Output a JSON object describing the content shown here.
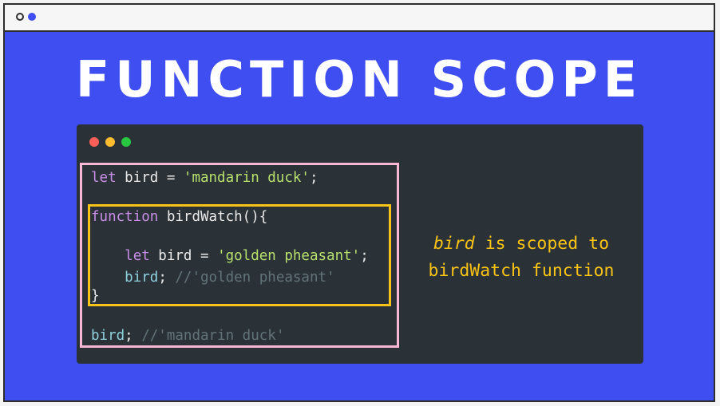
{
  "title": "FUNCTION SCOPE",
  "code": {
    "line1": {
      "kw": "let",
      "text": " bird = ",
      "str": "'mandarin duck'",
      "end": ";"
    },
    "line2": {
      "kw": "function",
      "text": " birdWatch(){"
    },
    "line3": {
      "indent": "    ",
      "kw": "let",
      "text": " bird = ",
      "str": "'golden pheasant'",
      "end": ";"
    },
    "line4": {
      "indent": "    ",
      "ref": "bird",
      "end": ";",
      "cmt": " //'golden pheasant'"
    },
    "line5": {
      "text": "}"
    },
    "line6": {
      "ref": "bird",
      "end": ";",
      "cmt": " //'mandarin duck'"
    }
  },
  "note": {
    "em": "bird",
    "rest1": " is scoped to",
    "line2": "birdWatch function"
  },
  "colors": {
    "background": "#3e4ef0",
    "code_bg": "#2b3237",
    "outer_box": "#f6b9d3",
    "inner_box": "#f8c216",
    "keyword": "#c98ee8",
    "string": "#b8e06e",
    "comment": "#627378",
    "note_text": "#f8c216"
  }
}
